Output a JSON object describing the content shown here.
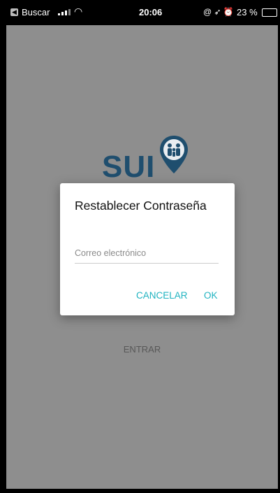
{
  "status_bar": {
    "carrier": "Buscar",
    "time": "20:06",
    "battery": "23 %",
    "icons": "@ ➶ ⏰",
    "back_icon": "back-arrow-icon"
  },
  "app": {
    "logo_text": "SUI",
    "login_button": "ENTRAR"
  },
  "dialog": {
    "title": "Restablecer Contraseña",
    "email_placeholder": "Correo electrónico",
    "email_value": "",
    "cancel_label": "CANCELAR",
    "ok_label": "OK"
  },
  "colors": {
    "accent": "#1fb3c0",
    "logo": "#1f4e6e",
    "overlay": "#8e8e8e"
  }
}
